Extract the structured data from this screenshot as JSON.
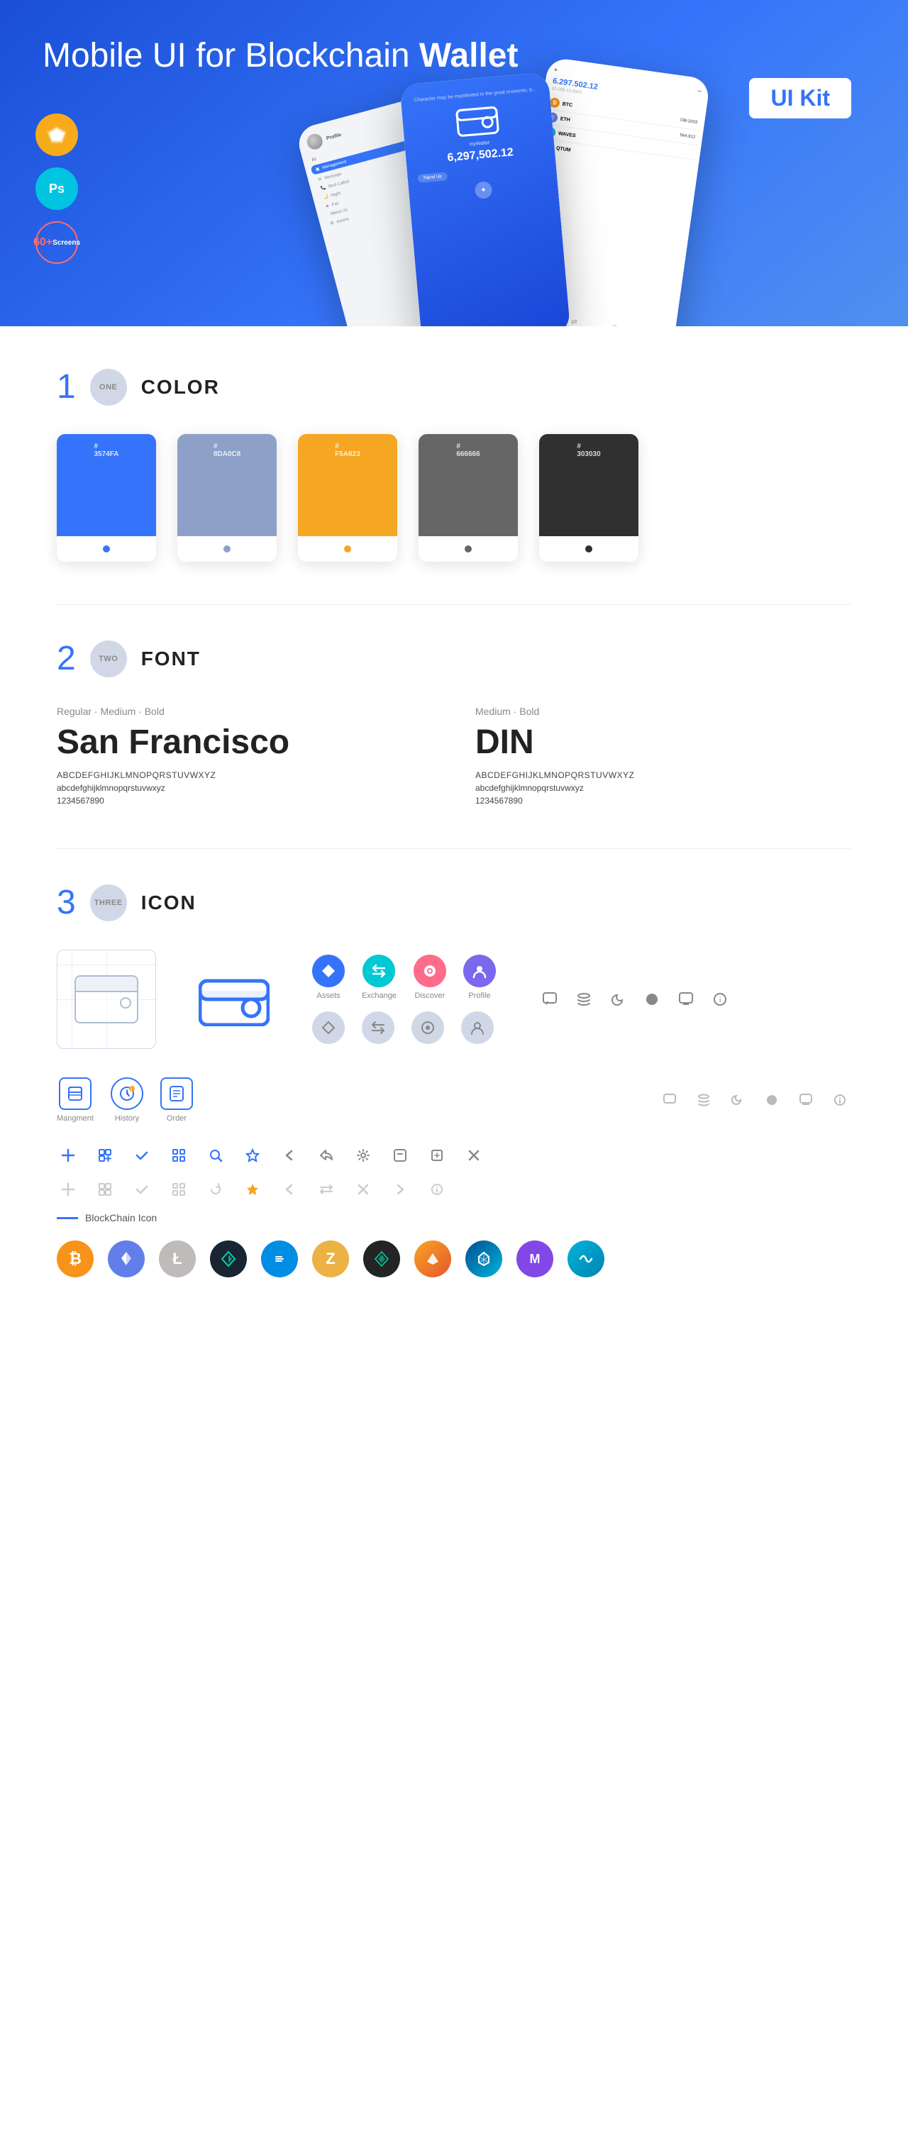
{
  "hero": {
    "title_regular": "Mobile UI for Blockchain ",
    "title_bold": "Wallet",
    "badge": "UI Kit",
    "sketch_label": "Sk",
    "ps_label": "Ps",
    "screens_label": "60+\nScreens"
  },
  "sections": {
    "color": {
      "number": "1",
      "circle_label": "ONE",
      "title": "COLOR",
      "swatches": [
        {
          "hex": "#3574FA",
          "label": "#\n3574FA",
          "dot_color": "#1a45d6"
        },
        {
          "hex": "#8DA0C8",
          "label": "#\n8DA0C8",
          "dot_color": "#6a82b0"
        },
        {
          "hex": "#F5A623",
          "label": "#\nF5A623",
          "dot_color": "#d4891a"
        },
        {
          "hex": "#666666",
          "label": "#\n666666",
          "dot_color": "#444"
        },
        {
          "hex": "#303030",
          "label": "#\n303030",
          "dot_color": "#111"
        }
      ]
    },
    "font": {
      "number": "2",
      "circle_label": "TWO",
      "title": "FONT",
      "font1": {
        "style_label": "Regular · Medium · Bold",
        "name": "San Francisco",
        "uppercase": "ABCDEFGHIJKLMNOPQRSTUVWXYZ",
        "lowercase": "abcdefghijklmnopqrstuvwxyz",
        "numbers": "1234567890"
      },
      "font2": {
        "style_label": "Medium · Bold",
        "name": "DIN",
        "uppercase": "ABCDEFGHIJKLMNOPQRSTUVWXYZ",
        "lowercase": "abcdefghijklmnopqrstuvwxyz",
        "numbers": "1234567890"
      }
    },
    "icon": {
      "number": "3",
      "circle_label": "THREE",
      "title": "ICON",
      "nav_icons": [
        {
          "label": "Assets",
          "type": "diamond",
          "color": "blue"
        },
        {
          "label": "Exchange",
          "type": "exchange",
          "color": "cyan"
        },
        {
          "label": "Discover",
          "type": "discover",
          "color": "coral"
        },
        {
          "label": "Profile",
          "type": "profile",
          "color": "purple"
        }
      ],
      "bottom_icons": [
        {
          "label": "Mangment",
          "type": "management"
        },
        {
          "label": "History",
          "type": "history"
        },
        {
          "label": "Order",
          "type": "order"
        }
      ],
      "misc_icons_row1": [
        "+",
        "⊞",
        "✓",
        "⊡",
        "🔍",
        "☆",
        "<",
        "<-",
        "⚙",
        "☐",
        "↔",
        "✕"
      ],
      "misc_icons_row2": [
        "+",
        "⊞",
        "✓",
        "⊡",
        "↺",
        "★",
        "<",
        "<->",
        "✕",
        "→",
        "ℹ"
      ],
      "blockchain_label": "BlockChain Icon",
      "crypto_icons": [
        {
          "name": "Bitcoin",
          "symbol": "₿",
          "color": "#f7931a"
        },
        {
          "name": "Ethereum",
          "symbol": "Ξ",
          "color": "#627eea"
        },
        {
          "name": "Litecoin",
          "symbol": "Ł",
          "color": "#bfbbbb"
        },
        {
          "name": "Wingriders",
          "symbol": "◆",
          "color": "#1a1a2e"
        },
        {
          "name": "Dash",
          "symbol": "D",
          "color": "#008ce7"
        },
        {
          "name": "Zcash",
          "symbol": "Z",
          "color": "#ecb244"
        },
        {
          "name": "IOTA",
          "symbol": "⬡",
          "color": "#242424"
        },
        {
          "name": "Ark",
          "symbol": "▲",
          "color": "#f5a623"
        },
        {
          "name": "Aion",
          "symbol": "◈",
          "color": "#004e92"
        },
        {
          "name": "Matic",
          "symbol": "M",
          "color": "#8247e5"
        },
        {
          "name": "SkyBridge",
          "symbol": "~",
          "color": "#00b4db"
        }
      ]
    }
  }
}
